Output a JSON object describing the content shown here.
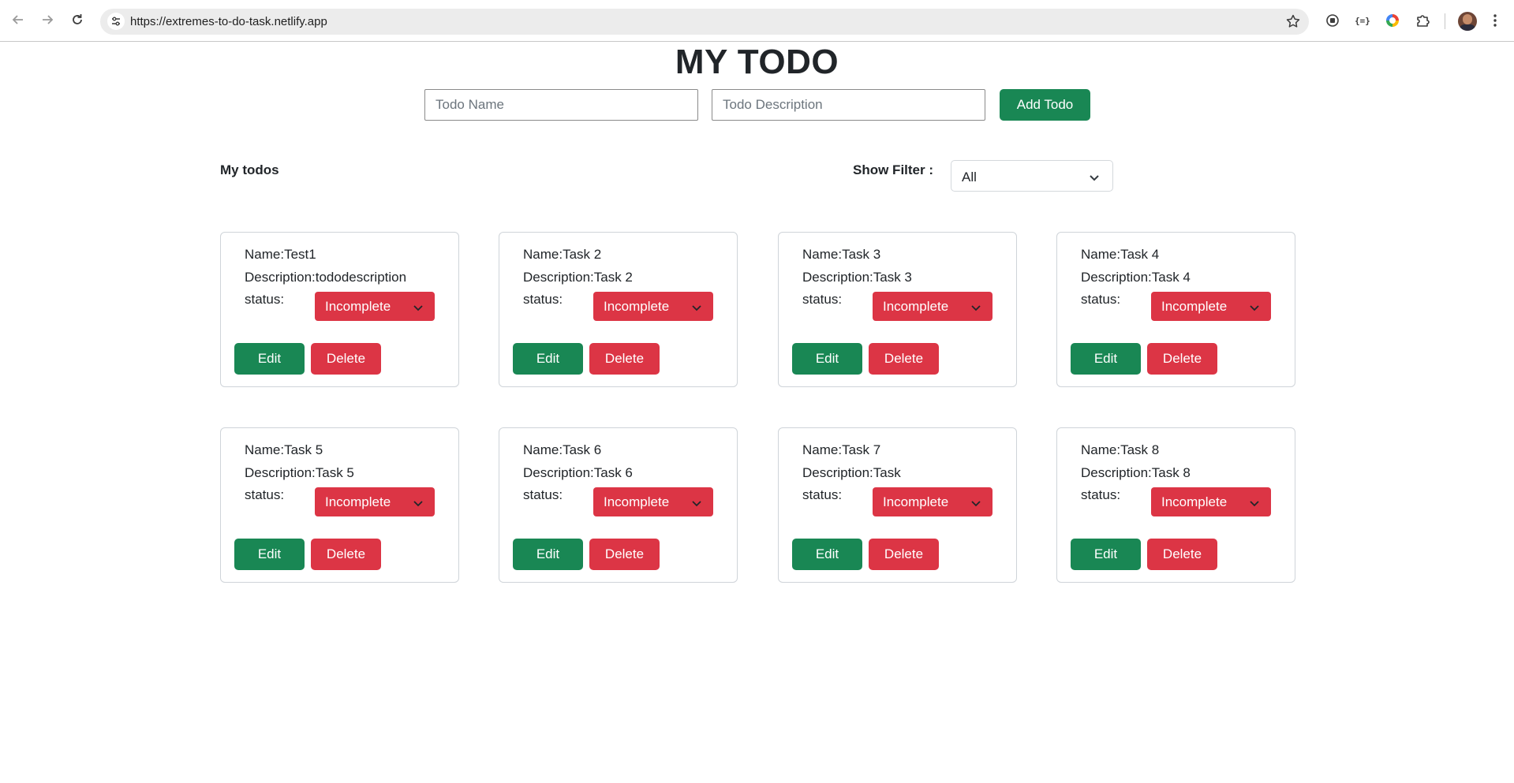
{
  "browser": {
    "url": "https://extremes-to-do-task.netlify.app"
  },
  "header": {
    "title": "MY TODO"
  },
  "form": {
    "name_placeholder": "Todo Name",
    "description_placeholder": "Todo Description",
    "add_label": "Add Todo"
  },
  "list": {
    "heading": "My todos",
    "filter_label": "Show Filter :",
    "filter_value": "All"
  },
  "todos": [
    {
      "name": "Name:Test1",
      "description": "Description:tododescription",
      "status_label": "status:",
      "status": "Incomplete",
      "edit": "Edit",
      "delete": "Delete"
    },
    {
      "name": "Name:Task 2",
      "description": "Description:Task 2",
      "status_label": "status:",
      "status": "Incomplete",
      "edit": "Edit",
      "delete": "Delete"
    },
    {
      "name": "Name:Task 3",
      "description": "Description:Task 3",
      "status_label": "status:",
      "status": "Incomplete",
      "edit": "Edit",
      "delete": "Delete"
    },
    {
      "name": "Name:Task 4",
      "description": "Description:Task 4",
      "status_label": "status:",
      "status": "Incomplete",
      "edit": "Edit",
      "delete": "Delete"
    },
    {
      "name": "Name:Task 5",
      "description": "Description:Task 5",
      "status_label": "status:",
      "status": "Incomplete",
      "edit": "Edit",
      "delete": "Delete"
    },
    {
      "name": "Name:Task 6",
      "description": "Description:Task 6",
      "status_label": "status:",
      "status": "Incomplete",
      "edit": "Edit",
      "delete": "Delete"
    },
    {
      "name": "Name:Task 7",
      "description": "Description:Task",
      "status_label": "status:",
      "status": "Incomplete",
      "edit": "Edit",
      "delete": "Delete"
    },
    {
      "name": "Name:Task 8",
      "description": "Description:Task 8",
      "status_label": "status:",
      "status": "Incomplete",
      "edit": "Edit",
      "delete": "Delete"
    }
  ],
  "colors": {
    "success": "#198754",
    "danger": "#dc3545",
    "text": "#212529"
  },
  "icons": {
    "back": "arrow-left-icon",
    "forward": "arrow-right-icon",
    "reload": "reload-icon",
    "site_info": "tune-icon",
    "bookmark": "star-icon",
    "extensions": [
      "record-icon",
      "code-braces-icon",
      "color-ring-icon",
      "puzzle-icon"
    ],
    "menu": "more-vertical-icon",
    "dropdown": "chevron-down-icon"
  }
}
